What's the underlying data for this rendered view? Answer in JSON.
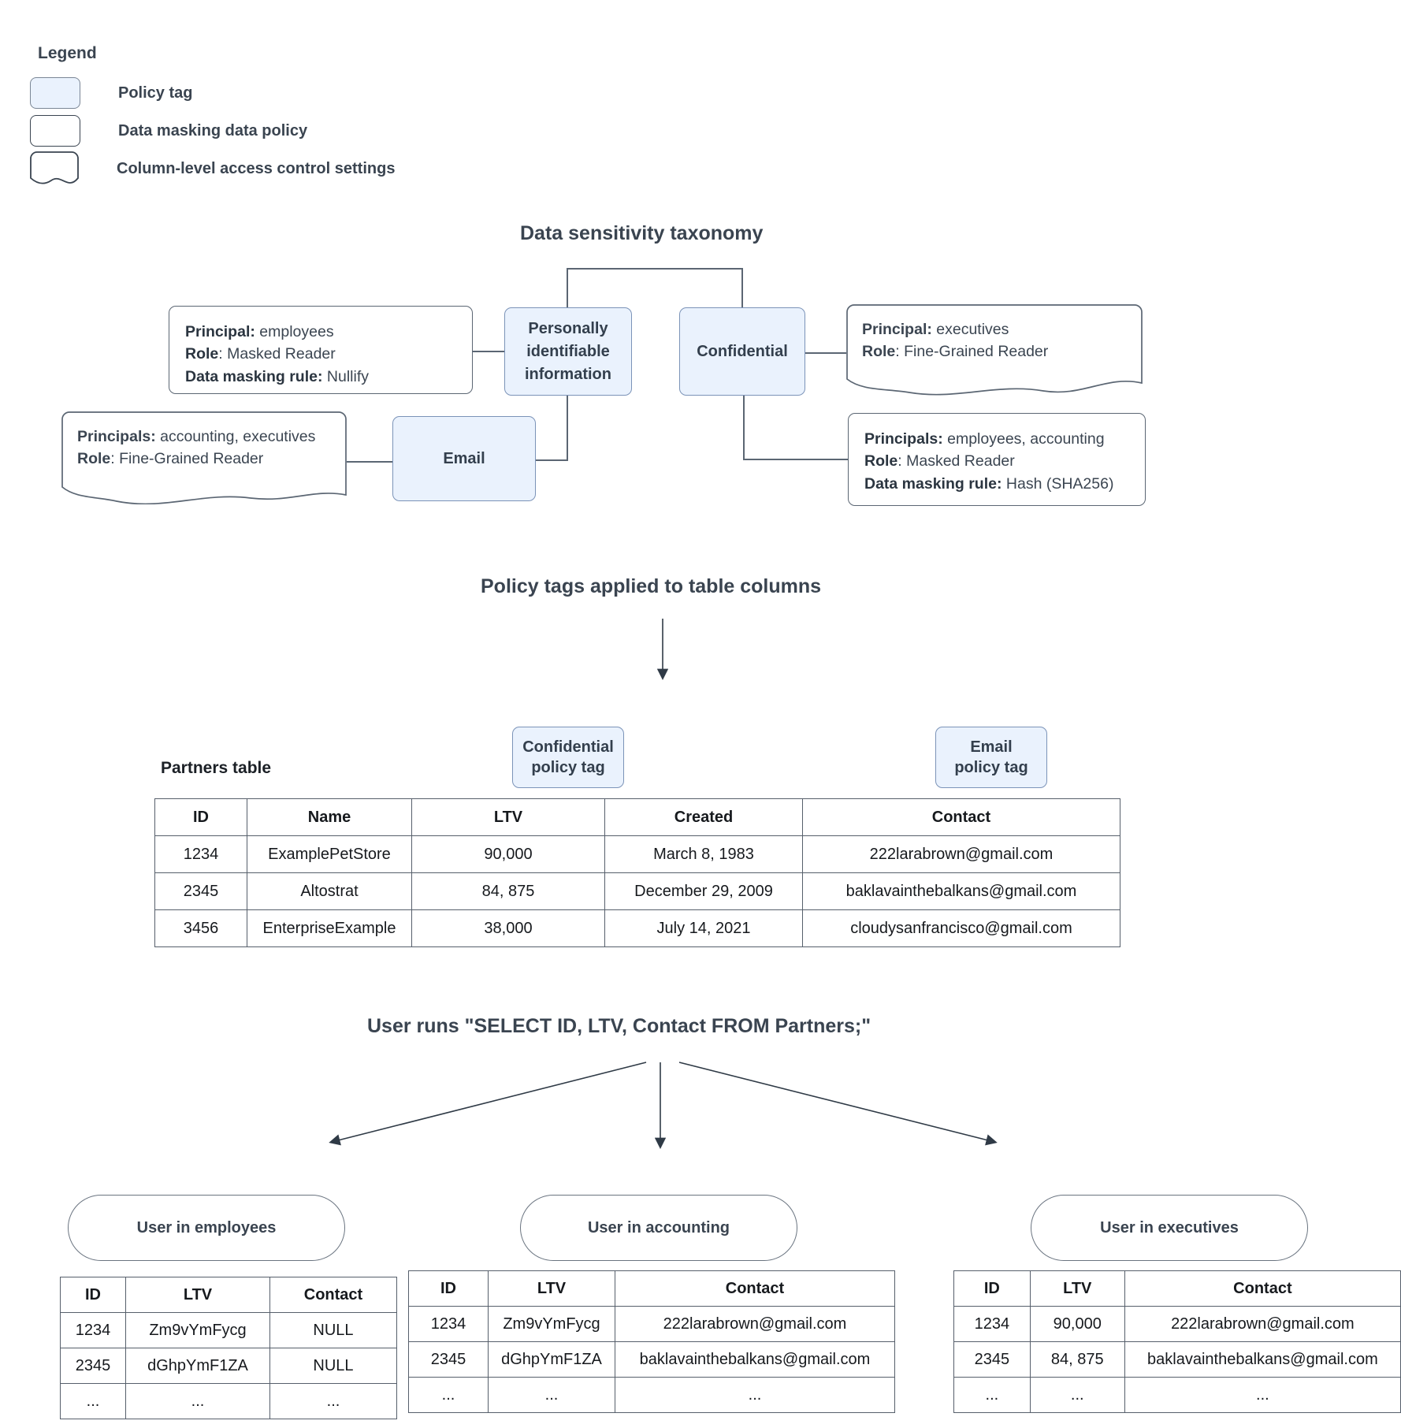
{
  "legend": {
    "title": "Legend",
    "items": [
      {
        "label": "Policy tag",
        "shape": "rounded-rect-filled"
      },
      {
        "label": "Data masking data policy",
        "shape": "rounded-rect"
      },
      {
        "label": "Column-level access control settings",
        "shape": "wavy-bottom-rect"
      }
    ]
  },
  "taxonomy": {
    "title": "Data sensitivity taxonomy",
    "tags": [
      {
        "id": "pii",
        "label": "Personally identifiable information"
      },
      {
        "id": "confidential",
        "label": "Confidential"
      },
      {
        "id": "email",
        "label": "Email"
      }
    ],
    "policies": [
      {
        "id": "pii-masking",
        "kind": "data-masking",
        "lines": [
          {
            "key": "Principal:",
            "value": " employees"
          },
          {
            "key": "Role",
            "value": ": Masked Reader"
          },
          {
            "key": "Data masking rule:",
            "value": " Nullify"
          }
        ]
      },
      {
        "id": "confidential-access",
        "kind": "column-level-access",
        "lines": [
          {
            "key": "Principal:",
            "value": " executives"
          },
          {
            "key": "Role",
            "value": ": Fine-Grained Reader"
          }
        ]
      },
      {
        "id": "email-access",
        "kind": "column-level-access",
        "lines": [
          {
            "key": "Principals:",
            "value": " accounting, executives"
          },
          {
            "key": "Role",
            "value": ": Fine-Grained Reader"
          }
        ]
      },
      {
        "id": "confidential-masking",
        "kind": "data-masking",
        "lines": [
          {
            "key": "Principals:",
            "value": " employees, accounting"
          },
          {
            "key": "Role",
            "value": ": Masked Reader"
          },
          {
            "key": "Data masking rule:",
            "value": " Hash (SHA256)"
          }
        ]
      }
    ]
  },
  "policy_tags_section": {
    "title": "Policy tags applied to table columns",
    "table_label": "Partners table",
    "column_tags": [
      {
        "label": "Confidential\npolicy tag",
        "line1": "Confidential",
        "line2": "policy tag",
        "column": "LTV"
      },
      {
        "label": "Email\npolicy tag",
        "line1": "Email",
        "line2": "policy tag",
        "column": "Contact"
      }
    ],
    "partners_table": {
      "columns": [
        "ID",
        "Name",
        "LTV",
        "Created",
        "Contact"
      ],
      "rows": [
        [
          "1234",
          "ExamplePetStore",
          "90,000",
          "March 8, 1983",
          "222larabrown@gmail.com"
        ],
        [
          "2345",
          "Altostrat",
          "84, 875",
          "December 29, 2009",
          "baklavainthebalkans@gmail.com"
        ],
        [
          "3456",
          "EnterpriseExample",
          "38,000",
          "July 14, 2021",
          "cloudysanfrancisco@gmail.com"
        ]
      ]
    }
  },
  "query_section": {
    "title": "User runs \"SELECT ID, LTV, Contact FROM Partners;\"",
    "results": [
      {
        "id": "employees",
        "actor": "User in employees",
        "columns": [
          "ID",
          "LTV",
          "Contact"
        ],
        "rows": [
          [
            "1234",
            "Zm9vYmFycg",
            "NULL"
          ],
          [
            "2345",
            "dGhpYmF1ZA",
            "NULL"
          ],
          [
            "...",
            "...",
            "..."
          ]
        ]
      },
      {
        "id": "accounting",
        "actor": "User in accounting",
        "columns": [
          "ID",
          "LTV",
          "Contact"
        ],
        "rows": [
          [
            "1234",
            "Zm9vYmFycg",
            "222larabrown@gmail.com"
          ],
          [
            "2345",
            "dGhpYmF1ZA",
            "baklavainthebalkans@gmail.com"
          ],
          [
            "...",
            "...",
            "..."
          ]
        ]
      },
      {
        "id": "executives",
        "actor": "User in executives",
        "columns": [
          "ID",
          "LTV",
          "Contact"
        ],
        "rows": [
          [
            "1234",
            "90,000",
            "222larabrown@gmail.com"
          ],
          [
            "2345",
            "84, 875",
            "baklavainthebalkans@gmail.com"
          ],
          [
            "...",
            "...",
            "..."
          ]
        ]
      }
    ]
  },
  "colors": {
    "tag_fill": "#eaf2fd",
    "tag_border": "#7b93b8",
    "node_border": "#5b6673",
    "text": "#3a4450",
    "table_border": "#565f6b",
    "arrow": "#2f3a46"
  }
}
